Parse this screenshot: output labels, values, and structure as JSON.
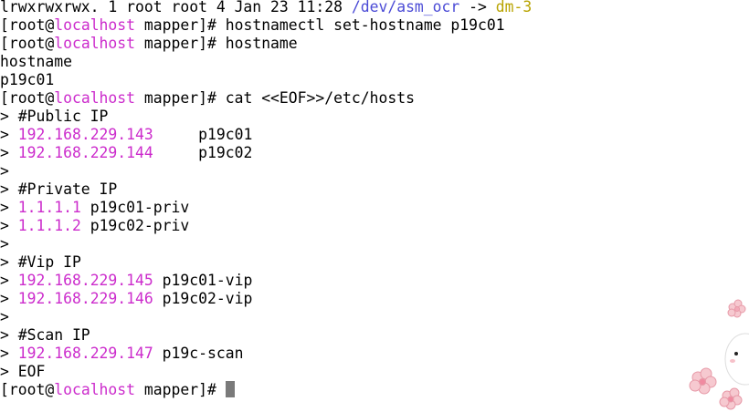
{
  "prompt": {
    "open": "[root@",
    "host": "localhost",
    "close": " mapper]# "
  },
  "lines": [
    {
      "segments": [
        {
          "text": "lrwxrwxrwx. 1 root root 4 Jan 23 11:28 ",
          "color": "default"
        },
        {
          "text": "/dev/asm_ocr",
          "color": "link"
        },
        {
          "text": " -> ",
          "color": "default"
        },
        {
          "text": "dm-3",
          "color": "dev"
        }
      ]
    },
    {
      "prompt": true,
      "segments": [
        {
          "text": "hostnamectl set-hostname p19c01",
          "color": "default"
        }
      ]
    },
    {
      "prompt": true,
      "segments": [
        {
          "text": "hostname",
          "color": "default"
        }
      ]
    },
    {
      "segments": [
        {
          "text": "hostname",
          "color": "default"
        }
      ]
    },
    {
      "segments": [
        {
          "text": "p19c01",
          "color": "default"
        }
      ]
    },
    {
      "prompt": true,
      "segments": [
        {
          "text": "cat <<EOF>>/etc/hosts",
          "color": "default"
        }
      ]
    },
    {
      "segments": [
        {
          "text": "> #Public IP",
          "color": "default"
        }
      ]
    },
    {
      "segments": [
        {
          "text": "> ",
          "color": "default"
        },
        {
          "text": "192.168.229.143",
          "color": "ip"
        },
        {
          "text": "     p19c01",
          "color": "default"
        }
      ]
    },
    {
      "segments": [
        {
          "text": "> ",
          "color": "default"
        },
        {
          "text": "192.168.229.144",
          "color": "ip"
        },
        {
          "text": "     p19c02",
          "color": "default"
        }
      ]
    },
    {
      "segments": [
        {
          "text": ">",
          "color": "default"
        }
      ]
    },
    {
      "segments": [
        {
          "text": "> #Private IP",
          "color": "default"
        }
      ]
    },
    {
      "segments": [
        {
          "text": "> ",
          "color": "default"
        },
        {
          "text": "1.1.1.1",
          "color": "ip"
        },
        {
          "text": " p19c01-priv",
          "color": "default"
        }
      ]
    },
    {
      "segments": [
        {
          "text": "> ",
          "color": "default"
        },
        {
          "text": "1.1.1.2",
          "color": "ip"
        },
        {
          "text": " p19c02-priv",
          "color": "default"
        }
      ]
    },
    {
      "segments": [
        {
          "text": ">",
          "color": "default"
        }
      ]
    },
    {
      "segments": [
        {
          "text": "> #Vip IP",
          "color": "default"
        }
      ]
    },
    {
      "segments": [
        {
          "text": "> ",
          "color": "default"
        },
        {
          "text": "192.168.229.145",
          "color": "ip"
        },
        {
          "text": " p19c01-vip",
          "color": "default"
        }
      ]
    },
    {
      "segments": [
        {
          "text": "> ",
          "color": "default"
        },
        {
          "text": "192.168.229.146",
          "color": "ip"
        },
        {
          "text": " p19c02-vip",
          "color": "default"
        }
      ]
    },
    {
      "segments": [
        {
          "text": ">",
          "color": "default"
        }
      ]
    },
    {
      "segments": [
        {
          "text": "> #Scan IP",
          "color": "default"
        }
      ]
    },
    {
      "segments": [
        {
          "text": "> ",
          "color": "default"
        },
        {
          "text": "192.168.229.147",
          "color": "ip"
        },
        {
          "text": " p19c-scan",
          "color": "default"
        }
      ]
    },
    {
      "segments": [
        {
          "text": "> EOF",
          "color": "default"
        }
      ]
    },
    {
      "prompt": true,
      "cursor": true,
      "segments": []
    }
  ],
  "colors": {
    "default": "#000000",
    "host": "#cc2ccc",
    "link": "#4b4bd6",
    "dev": "#b8a300",
    "ip": "#cc2ccc",
    "cursor": "#7a7a7a",
    "background": "#ffffff"
  },
  "decoration": {
    "icon": "cherry-blossom-sticker-icon"
  }
}
